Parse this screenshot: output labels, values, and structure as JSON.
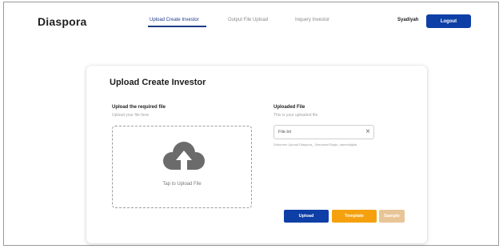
{
  "nav": {
    "brand": "Diaspora",
    "tabs": [
      {
        "label": "Upload Create Investor",
        "active": true
      },
      {
        "label": "Output File Upload",
        "active": false
      },
      {
        "label": "Inquery Investor",
        "active": false
      }
    ],
    "user": "Syadiyah",
    "logout_label": "Logout"
  },
  "card": {
    "title": "Upload Create Investor",
    "upload_section": {
      "label": "Upload the required file",
      "hint": "Upload your file here",
      "dropzone_text": "Tap to Upload File",
      "icon": "cloud-upload-icon"
    },
    "uploaded_section": {
      "label": "Uploaded File",
      "hint": "This is your uploaded file",
      "file_name": "File.txt",
      "file_path": "Dokumen Upload Diaspora_ Simulator/Single_name/digital"
    },
    "buttons": {
      "upload": "Upload",
      "template": "Template",
      "sample": "Sample"
    }
  },
  "colors": {
    "primary": "#0e3fa6",
    "template": "#f5a10f",
    "sample": "#e8c597",
    "cloud": "#6b6b6b"
  }
}
